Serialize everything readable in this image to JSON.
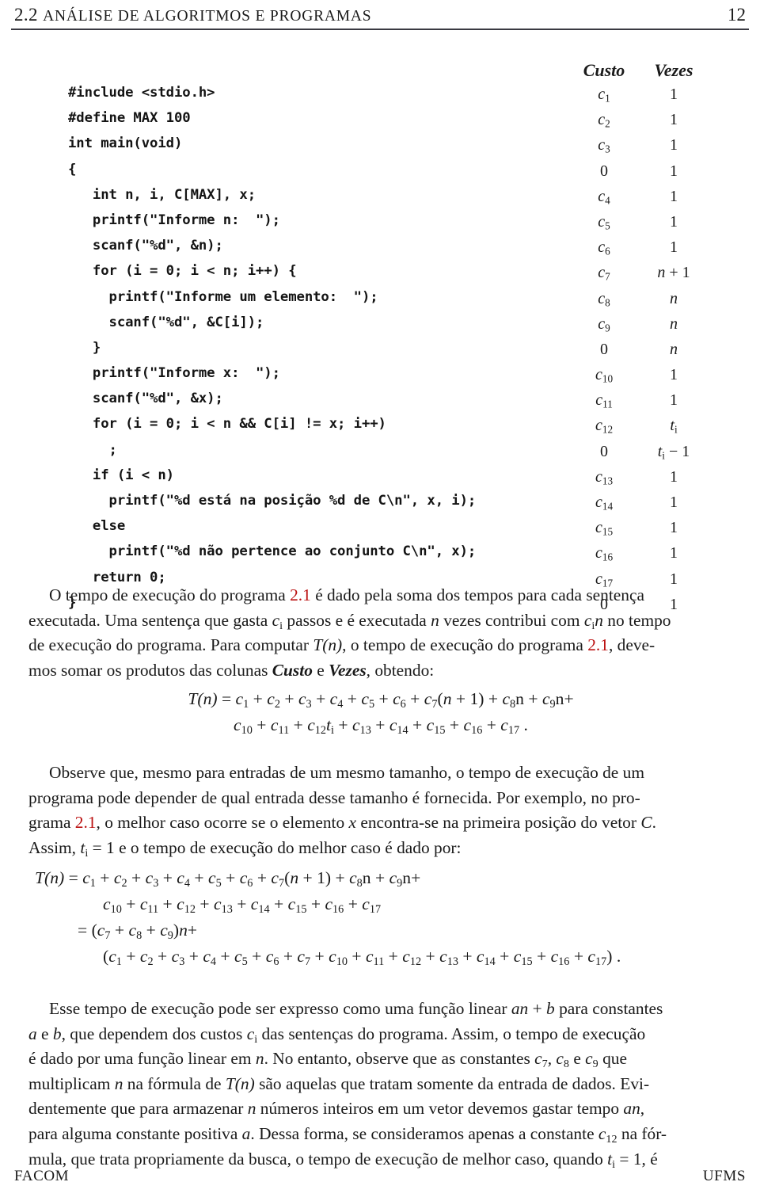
{
  "header": {
    "section_number": "2.2",
    "section_title": "ANÁLISE DE ALGORITMOS E PROGRAMAS",
    "page_number": "12"
  },
  "listing": {
    "column_headers": {
      "cost": "Custo",
      "times": "Vezes"
    },
    "rows": [
      {
        "code": "#include <stdio.h>",
        "cost": "c1",
        "times": "1"
      },
      {
        "code": "#define MAX 100",
        "cost": "c2",
        "times": "1"
      },
      {
        "code": "int main(void)",
        "cost": "c3",
        "times": "1"
      },
      {
        "code": "{",
        "cost": "0",
        "times": "1"
      },
      {
        "code": "   int n, i, C[MAX], x;",
        "cost": "c4",
        "times": "1"
      },
      {
        "code": "   printf(\"Informe n:  \");",
        "cost": "c5",
        "times": "1"
      },
      {
        "code": "   scanf(\"%d\", &n);",
        "cost": "c6",
        "times": "1"
      },
      {
        "code": "   for (i = 0; i < n; i++) {",
        "cost": "c7",
        "times": "n+1"
      },
      {
        "code": "     printf(\"Informe um elemento:  \");",
        "cost": "c8",
        "times": "n"
      },
      {
        "code": "     scanf(\"%d\", &C[i]);",
        "cost": "c9",
        "times": "n"
      },
      {
        "code": "   }",
        "cost": "0",
        "times": "n"
      },
      {
        "code": "   printf(\"Informe x:  \");",
        "cost": "c10",
        "times": "1"
      },
      {
        "code": "   scanf(\"%d\", &x);",
        "cost": "c11",
        "times": "1"
      },
      {
        "code": "   for (i = 0; i < n && C[i] != x; i++)",
        "cost": "c12",
        "times": "ti"
      },
      {
        "code": "     ;",
        "cost": "0",
        "times": "ti-1"
      },
      {
        "code": "   if (i < n)",
        "cost": "c13",
        "times": "1"
      },
      {
        "code": "     printf(\"%d está na posição %d de C\\n\", x, i);",
        "cost": "c14",
        "times": "1"
      },
      {
        "code": "   else",
        "cost": "c15",
        "times": "1"
      },
      {
        "code": "     printf(\"%d não pertence ao conjunto C\\n\", x);",
        "cost": "c16",
        "times": "1"
      },
      {
        "code": "   return 0;",
        "cost": "c17",
        "times": "1"
      },
      {
        "code": "}",
        "cost": "0",
        "times": "1"
      }
    ]
  },
  "paragraph1": {
    "line1_a": "O tempo de execução do programa ",
    "line1_ref": "2.1",
    "line1_b": " é dado pela soma dos tempos para cada sentença",
    "line2_a": "executada. Uma sentença que gasta ",
    "line2_b": " passos e é executada ",
    "line2_c": " vezes contribui com ",
    "line2_d": " no tempo",
    "line3_a": "de execução do programa.  Para computar ",
    "line3_b": ", o tempo de execução do programa ",
    "line3_ref": "2.1",
    "line3_c": ", deve-",
    "line4_a": "mos somar os produtos das colunas ",
    "line4_bold1": "Custo",
    "line4_b": " e ",
    "line4_bold2": "Vezes",
    "line4_c": ", obtendo:"
  },
  "equation1": {
    "line1": "T(n) = c1 + c2 + c3 + c4 + c5 + c6 + c7(n + 1) + c8n + c9n+",
    "line2": "c10 + c11 + c12ti + c13 + c14 + c15 + c16 + c17 ."
  },
  "paragraph2": {
    "line1": "Observe que, mesmo para entradas de um mesmo tamanho, o tempo de execução de um",
    "line2": "programa pode depender de qual entrada desse tamanho é fornecida.  Por exemplo, no pro-",
    "line3_a": "grama ",
    "line3_ref": "2.1",
    "line3_b": ", o melhor caso ocorre se o elemento ",
    "line3_c": " encontra-se na primeira posição do vetor ",
    "line3_d": ".",
    "line4_a": "Assim, ",
    "line4_b": " e o tempo de execução do melhor caso é dado por:"
  },
  "equation2": {
    "line1": "T(n) = c1 + c2 + c3 + c4 + c5 + c6 + c7(n + 1) + c8n + c9n+",
    "line2": "c10 + c11 + c12 + c13 + c14 + c15 + c16 + c17",
    "line3": "= (c7 + c8 + c9)n+",
    "line4": "(c1 + c2 + c3 + c4 + c5 + c6 + c7 + c10 + c11 + c12 + c13 + c14 + c15 + c16 + c17) ."
  },
  "paragraph3": {
    "line1_a": "Esse tempo de execução pode ser expresso como uma função linear ",
    "line1_b": " para constantes",
    "line2_a": " e ",
    "line2_b": ", que dependem dos custos ",
    "line2_c": " das sentenças do programa.  Assim, o tempo de execução",
    "line3_a": "é dado por uma função linear em ",
    "line3_b": ".  No entanto, observe que as constantes ",
    "line3_c": " e ",
    "line3_d": " que",
    "line4_a": "multiplicam ",
    "line4_b": " na fórmula de ",
    "line4_c": " são aquelas que tratam somente da entrada de dados.  Evi-",
    "line5_a": "dentemente que para armazenar ",
    "line5_b": " números inteiros em um vetor devemos gastar tempo ",
    "line5_c": ",",
    "line6_a": "para alguma constante positiva ",
    "line6_b": ". Dessa forma, se consideramos apenas a constante ",
    "line6_c": " na fór-",
    "line7_a": "mula, que trata propriamente da busca, o tempo de execução de melhor caso, quando ",
    "line7_b": ", é"
  },
  "footer": {
    "left": "FACOM",
    "right": "UFMS"
  }
}
